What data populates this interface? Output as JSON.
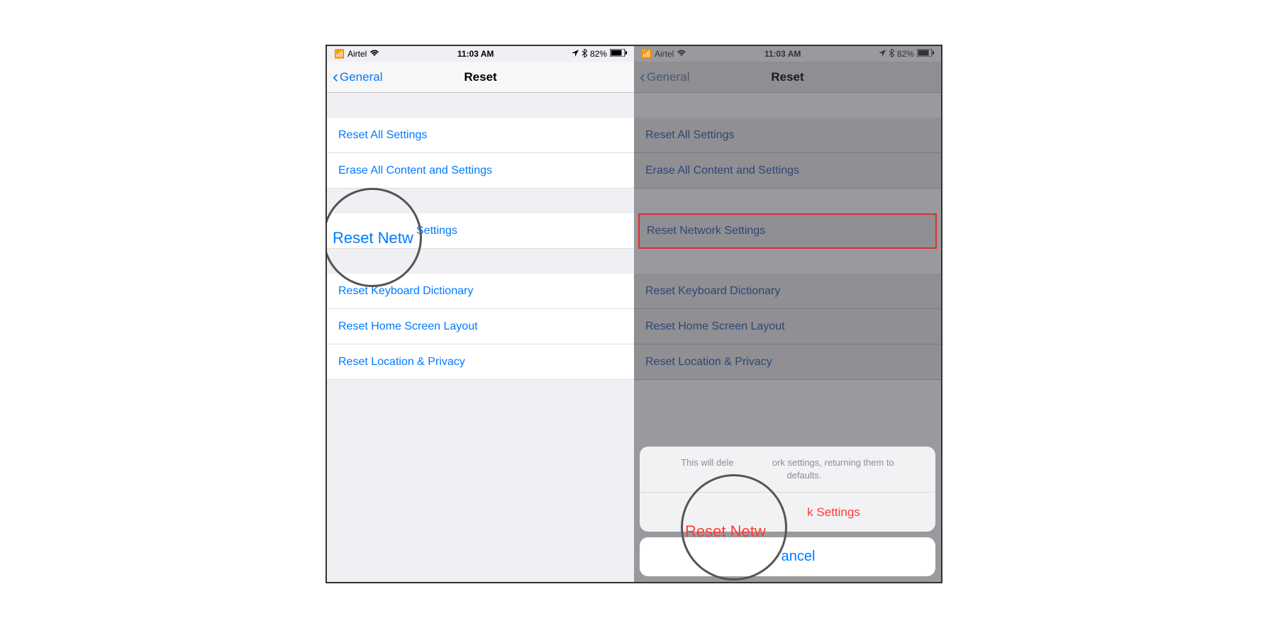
{
  "status": {
    "carrier": "Airtel",
    "time": "11:03 AM",
    "battery_pct": "82%"
  },
  "nav": {
    "back_label": "General",
    "title": "Reset"
  },
  "items": {
    "reset_all": "Reset All Settings",
    "erase_all": "Erase All Content and Settings",
    "reset_network": "Reset Network Settings",
    "reset_keyboard": "Reset Keyboard Dictionary",
    "reset_home": "Reset Home Screen Layout",
    "reset_location": "Reset Location & Privacy"
  },
  "action_sheet": {
    "message": "This will delete all network settings, returning them to factory defaults.",
    "confirm": "Reset Network Settings",
    "cancel": "Cancel"
  },
  "zoom": {
    "left_partial": "Reset Netw",
    "left_rest": "Settings",
    "right_partial": "Reset Netw",
    "right_rest": "k Settings",
    "cancel_partial": "ancel"
  }
}
